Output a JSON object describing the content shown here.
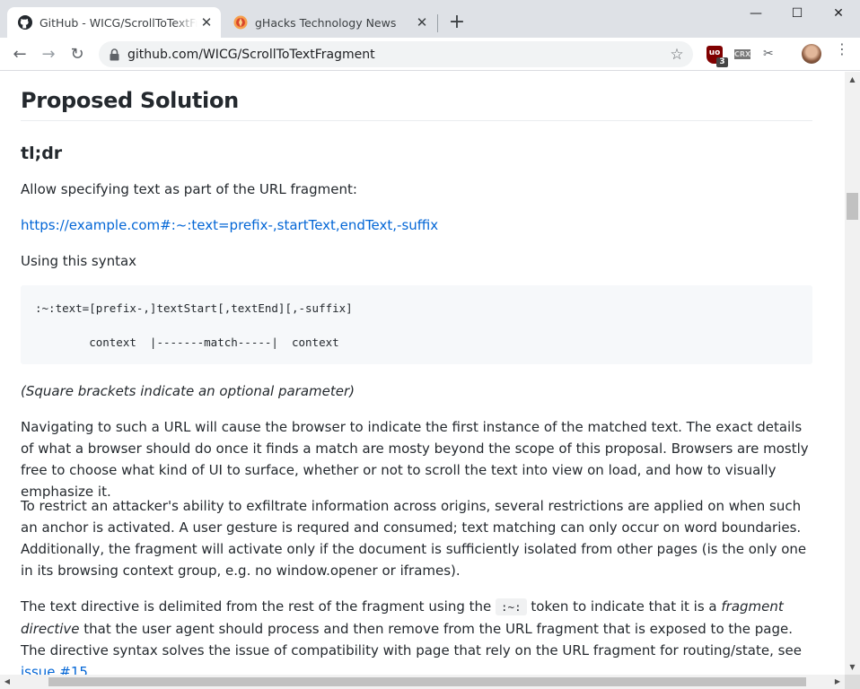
{
  "browser": {
    "tabs": [
      {
        "title": "GitHub - WICG/ScrollToTextFragment",
        "favicon": "github-icon",
        "active": true,
        "close": "✕"
      },
      {
        "title": "gHacks Technology News",
        "favicon": "ghacks-icon",
        "active": false,
        "close": "✕"
      }
    ],
    "new_tab": "+",
    "window_controls": {
      "minimize": "—",
      "maximize": "☐",
      "close": "✕"
    },
    "toolbar": {
      "back": "←",
      "forward": "→",
      "reload": "↻",
      "url": "github.com/WICG/ScrollToTextFragment",
      "star": "☆"
    },
    "extensions": {
      "ublock_label": "uo",
      "ublock_badge": "3",
      "crx_label": "CRX",
      "scissors": "✂",
      "menu": "⋮"
    }
  },
  "doc": {
    "heading": "Proposed Solution",
    "subheading": "tl;dr",
    "p1": "Allow specifying text as part of the URL fragment:",
    "example_link": "https://example.com#:~:text=prefix-,startText,endText,-suffix",
    "p2": "Using this syntax",
    "code_line1": ":~:text=[prefix-,]textStart[,textEnd][,-suffix]",
    "code_line2": "        context  |-------match-----|  context",
    "note": "(Square brackets indicate an optional parameter)",
    "p3": "Navigating to such a URL will cause the browser to indicate the first instance of the matched text. The exact details of what a browser should do once it finds a match are mosty beyond the scope of this proposal. Browsers are mostly free to choose what kind of UI to surface, whether or not to scroll the text into view on load, and how to visually emphasize it.",
    "p4": "To restrict an attacker's ability to exfiltrate information across origins, several restrictions are applied on when such an anchor is activated. A user gesture is requred and consumed; text matching can only occur on word boundaries. Additionally, the fragment will activate only if the document is sufficiently isolated from other pages (is the only one in its browsing context group, e.g. no window.opener or iframes).",
    "p5_a": "The text directive is delimited from the rest of the fragment using the",
    "p5_code": ":~:",
    "p5_b": "token to indicate that it is a",
    "p5_em": "fragment directive",
    "p5_c": "that the user agent should process and then remove from the URL fragment that is exposed to the page. The directive syntax solves the issue of compatibility with page that rely on the URL fragment for routing/state, see",
    "p5_link": "issue #15",
    "p5_end": "."
  },
  "scrollbars": {
    "up": "▲",
    "down": "▼",
    "left": "◀",
    "right": "▶"
  }
}
